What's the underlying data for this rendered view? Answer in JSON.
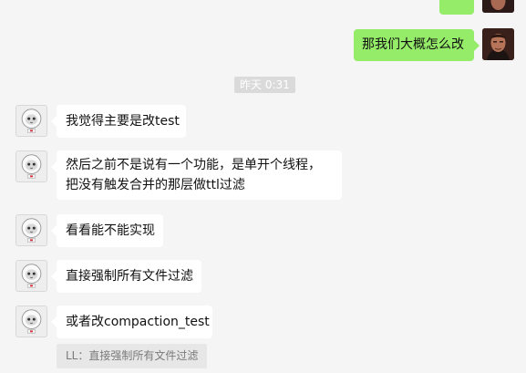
{
  "timestamp": "昨天 0:31",
  "outgoing": [
    {
      "text": "那我们大概怎么改"
    }
  ],
  "incoming": [
    {
      "text": "我觉得主要是改test"
    },
    {
      "text": "然后之前不是说有一个功能，是单开个线程，把没有触发合并的那层做ttl过滤"
    },
    {
      "text": "看看能不能实现"
    },
    {
      "text": "直接强制所有文件过滤"
    },
    {
      "text": "或者改compaction_test"
    }
  ],
  "quote": {
    "text": "LL：直接强制所有文件过滤"
  },
  "colors": {
    "background": "#f5f5f5",
    "outgoing_bubble": "#95ec69",
    "incoming_bubble": "#ffffff",
    "timestamp_badge": "#dadada",
    "quote_bg": "#e7e7e7"
  }
}
